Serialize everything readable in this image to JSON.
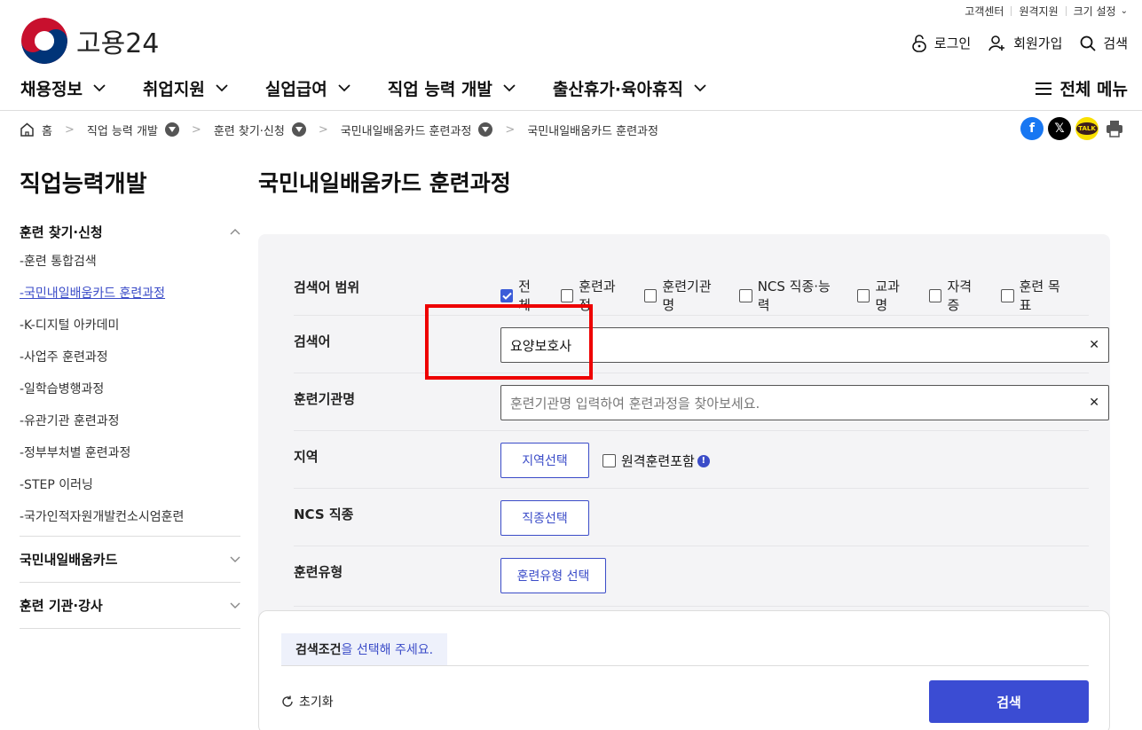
{
  "util": {
    "customer": "고객센터",
    "remote": "원격지원",
    "size": "크기 설정"
  },
  "logo": {
    "text": "고용24"
  },
  "gnb": {
    "login": "로그인",
    "join": "회원가입",
    "search": "검색"
  },
  "mainnav": [
    "채용정보",
    "취업지원",
    "실업급여",
    "직업 능력 개발",
    "출산휴가·육아휴직"
  ],
  "allmenu": "전체 메뉴",
  "breadcrumb": {
    "home": "홈",
    "c1": "직업 능력 개발",
    "c2": "훈련 찾기·신청",
    "c3": "국민내일배움카드 훈련과정",
    "c4": "국민내일배움카드 훈련과정"
  },
  "share": {
    "kakao": "TALK"
  },
  "lnb": {
    "title": "직업능력개발",
    "group1": "훈련 찾기·신청",
    "items": [
      "-훈련 통합검색",
      "-국민내일배움카드 훈련과정",
      "-K-디지털 아카데미",
      "-사업주 훈련과정",
      "-일학습병행과정",
      "-유관기관 훈련과정",
      "-정부부처별 훈련과정",
      "-STEP 이러닝",
      "-국가인적자원개발컨소시엄훈련"
    ],
    "group2": "국민내일배움카드",
    "group3": "훈련 기관·강사"
  },
  "page_title": "국민내일배움카드 훈련과정",
  "form": {
    "scope_label": "검색어 범위",
    "scope_options": [
      "전체",
      "훈련과정",
      "훈련기관명",
      "NCS 직종·능력",
      "교과명",
      "자격증",
      "훈련 목표"
    ],
    "keyword_label": "검색어",
    "keyword_value": "요양보호사",
    "org_label": "훈련기관명",
    "org_placeholder": "훈련기관명 입력하여 훈련과정을 찾아보세요.",
    "region_label": "지역",
    "region_btn": "지역선택",
    "remote_label": "원격훈련포함",
    "ncs_label": "NCS 직종",
    "ncs_btn": "직종선택",
    "type_label": "훈련유형",
    "type_btn": "훈련유형 선택"
  },
  "bottom": {
    "cond_a": "검색조건",
    "cond_b": "을 선택해 주세요.",
    "reset": "초기화",
    "search": "검색"
  }
}
